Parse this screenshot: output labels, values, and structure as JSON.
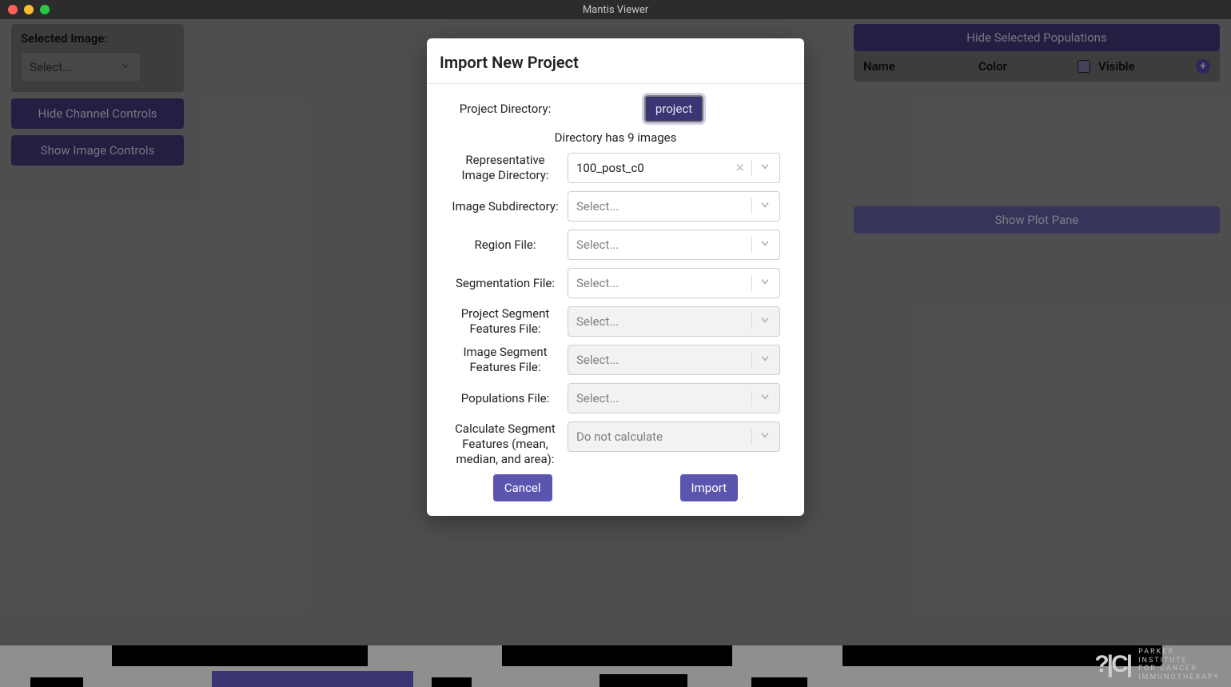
{
  "window": {
    "title": "Mantis Viewer"
  },
  "left": {
    "selected_image_label": "Selected Image:",
    "select_placeholder": "Select...",
    "hide_channel_controls": "Hide Channel Controls",
    "show_image_controls": "Show Image Controls"
  },
  "right": {
    "hide_selected_populations": "Hide Selected Populations",
    "col_name": "Name",
    "col_color": "Color",
    "col_visible": "Visible",
    "show_plot_pane": "Show Plot Pane"
  },
  "modal": {
    "title": "Import New Project",
    "labels": {
      "project_directory": "Project Directory:",
      "representative_image_directory": "Representative Image Directory:",
      "image_subdirectory": "Image Subdirectory:",
      "region_file": "Region File:",
      "segmentation_file": "Segmentation File:",
      "project_segment_features_file": "Project Segment Features File:",
      "image_segment_features_file": "Image Segment Features File:",
      "populations_file": "Populations File:",
      "calculate": "Calculate Segment Features (mean, median, and area):"
    },
    "values": {
      "project_button": "project",
      "directory_info": "Directory has 9 images",
      "representative_image_value": "100_post_c0",
      "select_placeholder": "Select...",
      "calculate_placeholder": "Do not calculate"
    },
    "actions": {
      "cancel": "Cancel",
      "import": "Import"
    }
  },
  "footer": {
    "logo_mark": "?|C|",
    "line1": "PARKER",
    "line2": "INSTITUTE",
    "line3": "FOR CANCER",
    "line4": "IMMUNOTHERAPY"
  }
}
